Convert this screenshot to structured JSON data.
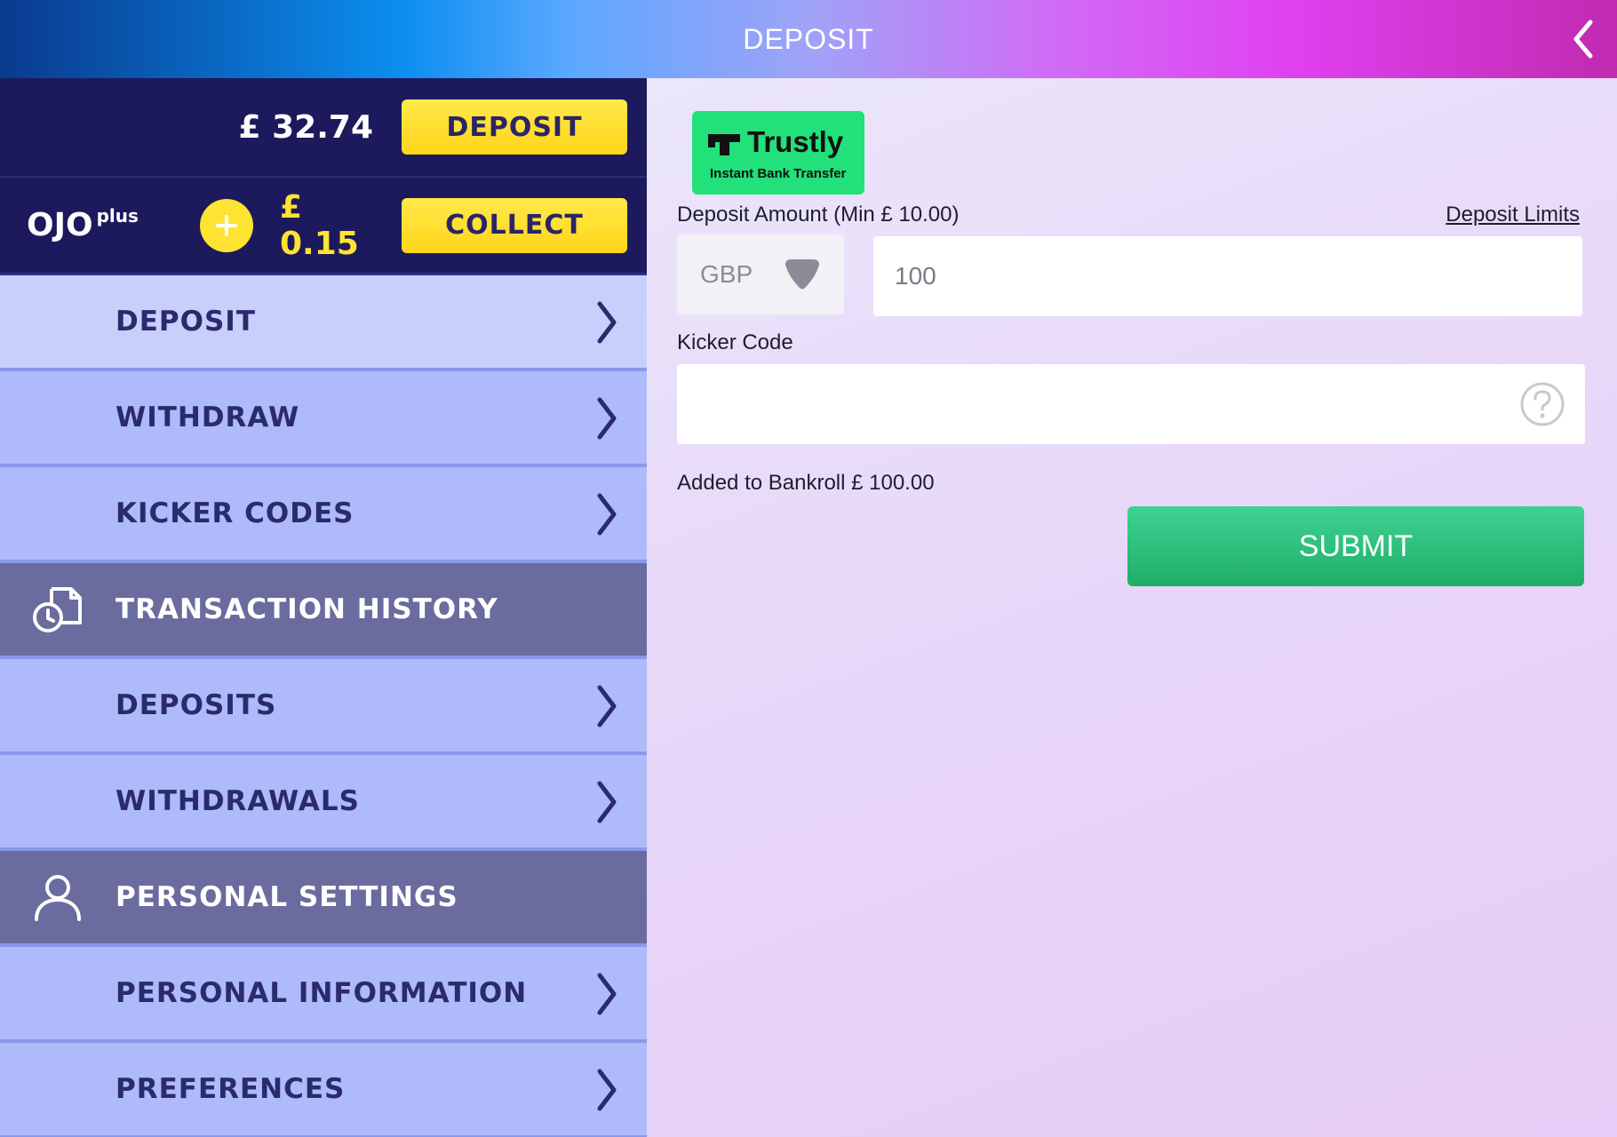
{
  "header": {
    "title": "DEPOSIT"
  },
  "balance": {
    "amount": "£ 32.74",
    "deposit_label": "DEPOSIT"
  },
  "ojo_plus": {
    "brand": "OJO",
    "brand_sup": "plus",
    "amount": "£ 0.15",
    "collect_label": "COLLECT"
  },
  "menu": {
    "banking": [
      {
        "label": "DEPOSIT"
      },
      {
        "label": "WITHDRAW"
      },
      {
        "label": "KICKER CODES"
      }
    ],
    "transaction_history": {
      "title": "TRANSACTION HISTORY",
      "items": [
        {
          "label": "DEPOSITS"
        },
        {
          "label": "WITHDRAWALS"
        }
      ]
    },
    "personal_settings": {
      "title": "PERSONAL SETTINGS",
      "items": [
        {
          "label": "PERSONAL INFORMATION"
        },
        {
          "label": "PREFERENCES"
        }
      ]
    }
  },
  "form": {
    "provider": {
      "name": "Trustly",
      "subtitle": "Instant Bank Transfer"
    },
    "amount_label": "Deposit Amount  (Min  £ 10.00)",
    "limits_link": "Deposit Limits",
    "currency": "GBP",
    "amount_value": "100",
    "kicker_label": "Kicker Code",
    "kicker_value": "",
    "bankroll_text": "Added to Bankroll  £ 100.00",
    "submit_label": "SUBMIT"
  },
  "colors": {
    "sidebar_dark": "#1c1a5c",
    "menu_item": "#aebafa",
    "section_header": "#6a6b9e",
    "yellow": "#ffd51a",
    "submit_green": "#26b872",
    "trustly_green": "#22e07a"
  },
  "icons": {
    "back": "chevron-left-icon",
    "chevron": "chevron-right-icon",
    "plus": "plus-circle-icon",
    "history": "transaction-history-icon",
    "person": "person-icon",
    "dropdown": "dropdown-arrow-icon",
    "help": "question-circle-icon"
  }
}
